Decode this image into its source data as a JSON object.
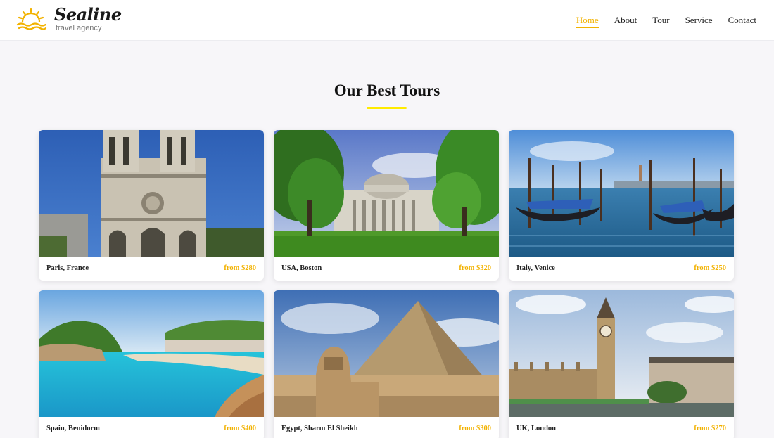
{
  "brand": {
    "name": "Sealine",
    "tagline": "travel agency",
    "accent_color": "#f2b200",
    "logo_icon": "sun-waves-icon"
  },
  "nav": {
    "items": [
      {
        "label": "Home",
        "active": true
      },
      {
        "label": "About",
        "active": false
      },
      {
        "label": "Tour",
        "active": false
      },
      {
        "label": "Service",
        "active": false
      },
      {
        "label": "Contact",
        "active": false
      }
    ]
  },
  "section": {
    "title": "Our Best Tours",
    "rule_color": "#ffeb00"
  },
  "tours": [
    {
      "place": "Paris, France",
      "price": "from $280",
      "image": "notre-dame-cathedral"
    },
    {
      "place": "USA, Boston",
      "price": "from $320",
      "image": "domed-university-building"
    },
    {
      "place": "Italy, Venice",
      "price": "from $250",
      "image": "venice-gondolas"
    },
    {
      "place": "Spain, Benidorm",
      "price": "from $400",
      "image": "mediterranean-beach"
    },
    {
      "place": "Egypt, Sharm El Sheikh",
      "price": "from $300",
      "image": "sphinx-and-pyramid"
    },
    {
      "place": "UK, London",
      "price": "from $270",
      "image": "big-ben-westminster"
    }
  ]
}
